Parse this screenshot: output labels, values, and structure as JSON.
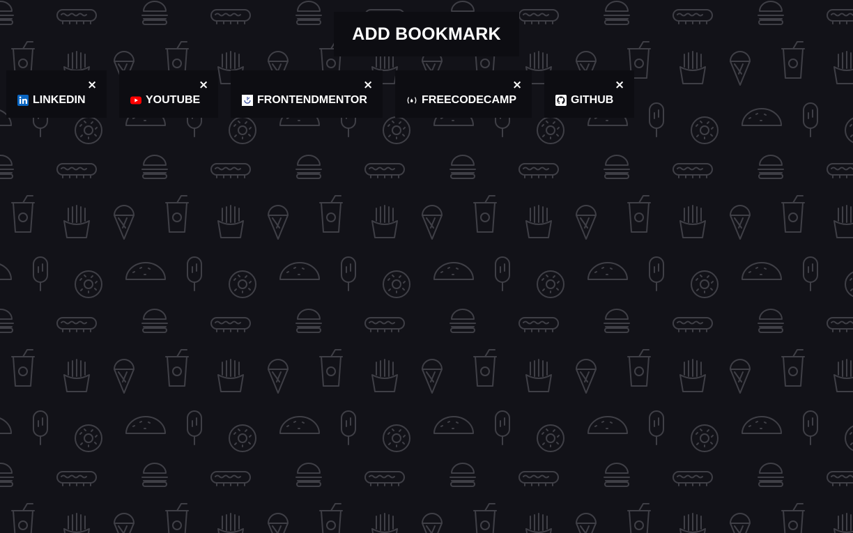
{
  "page": {
    "background_color": "#121218",
    "pattern_color": "#3f3f46"
  },
  "add_button": {
    "label": "ADD BOOKMARK"
  },
  "bookmarks": [
    {
      "label": "LINKEDIN",
      "icon": "linkedin-icon",
      "close": "×"
    },
    {
      "label": "YOUTUBE",
      "icon": "youtube-icon",
      "close": "×"
    },
    {
      "label": "FRONTENDMENTOR",
      "icon": "frontendmentor-icon",
      "close": "×"
    },
    {
      "label": "FREECODECAMP",
      "icon": "freecodecamp-icon",
      "close": "×"
    },
    {
      "label": "GITHUB",
      "icon": "github-icon",
      "close": "×"
    }
  ]
}
